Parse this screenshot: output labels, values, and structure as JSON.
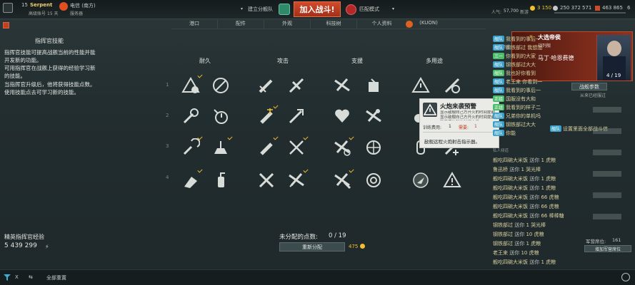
{
  "topbar": {
    "player_name": "Serpent",
    "player_level": "15",
    "player_rank": "高级账号",
    "player_sub": "15 天",
    "server_name": "电信 (南方)",
    "server_sub": "服务器",
    "division_label": "建立分舰队",
    "battle_button": "加入战斗!",
    "battle_mode": "匹配模式",
    "online_label": "人气:",
    "online_count": "57,700",
    "players_label": "新游",
    "doubloons": "3 150",
    "credits": "250 372",
    "free_xp": "571",
    "coal": "463 865",
    "currency_extra": "6"
  },
  "subnav": {
    "tabs": [
      "港口",
      "配件",
      "外观",
      "科技树",
      "个人资料",
      "(KUON)"
    ]
  },
  "left_panel": {
    "title": "指挥官技能",
    "paragraphs": [
      "指挥官技能可提高战舰当前的性能并能开发新的功能。",
      "可用指挥官在战舰上获得的经验学习新的技能。",
      "当指挥官升级后，他将获得技能点数。使用技能点去可学习新的技能。"
    ],
    "elite_xp_label": "精英指挥官经验",
    "elite_xp_value": "5 439 299"
  },
  "categories": [
    "耐久",
    "攻击",
    "支援",
    "多用途"
  ],
  "skills": {
    "row_labels": [
      "1",
      "2",
      "3",
      "4"
    ]
  },
  "points": {
    "label": "未分配的点数:",
    "value": "0 / 19",
    "reset_button": "重新分配",
    "reset_cost": "475"
  },
  "tooltip": {
    "title": "火炮来袭预警",
    "desc": "显示敌舰向己方开火的时间提前显示敌舰向己方开火的时间提前和来袭炮弹的时间大于",
    "cost_label": "训练费用:",
    "cost_value": "1",
    "req_label": "需要:",
    "req_value": "1",
    "footer": "敌舰远程火炮射击指示器。"
  },
  "ship_card": {
    "title": "大选帝侯",
    "subtitle": "战列舰",
    "commander": "马丁·哈恩费德",
    "level_text": "4 / 19",
    "details_button": "战舰参数",
    "note": "从来已经服过",
    "tier": "X"
  },
  "chat": {
    "header": "公频频道",
    "lines": [
      {
        "tag": "舰队",
        "text": "我看到的事后一"
      },
      {
        "tag": "舰队",
        "text": "钢铁部过 我想加"
      },
      {
        "tag": "三一",
        "text": "你看到的大家"
      },
      {
        "tag": "舰队",
        "text": "钢铁部过大大"
      },
      {
        "tag": "舰队",
        "text": "我也好你看到"
      },
      {
        "tag": "舰队",
        "text": "老王来 你看到一"
      },
      {
        "tag": "舰队",
        "text": "我看到的事后一"
      },
      {
        "tag": "正组",
        "text": "国服没有大和"
      },
      {
        "tag": "正组",
        "text": "我看到的样子二"
      },
      {
        "tag": "舰队",
        "text": "兄弟你的单机吗"
      },
      {
        "tag": "舰队",
        "text": "钢铁部过大大"
      },
      {
        "tag": "舰队",
        "text": "你能"
      },
      {
        "tag": "舰队",
        "text": "设置里面全部战斗信"
      }
    ],
    "system_header": "私人频道",
    "gifts": [
      {
        "name": "舰吃四碗大米饭",
        "verb": "送你",
        "qty": "1",
        "item": "虎粮"
      },
      {
        "name": "鲁迅桥",
        "verb": "送你",
        "qty": "1",
        "item": "哭光棒"
      },
      {
        "name": "舰吃四碗大米饭",
        "verb": "送你",
        "qty": "1",
        "item": "虎粮"
      },
      {
        "name": "舰吃四碗大米饭",
        "verb": "送你",
        "qty": "1",
        "item": "虎粮"
      },
      {
        "name": "舰吃四碗大米饭",
        "verb": "送你",
        "qty": "66",
        "item": "虎粮"
      },
      {
        "name": "舰吃四碗大米饭",
        "verb": "送你",
        "qty": "66",
        "item": "虎粮"
      },
      {
        "name": "舰吃四碗大米饭",
        "verb": "送你",
        "qty": "66",
        "item": "棒棒糖"
      },
      {
        "name": "钢铁部过",
        "verb": "送你",
        "qty": "1",
        "item": "哭光棒"
      },
      {
        "name": "钢铁部过",
        "verb": "送你",
        "qty": "10",
        "item": "虎粮"
      },
      {
        "name": "钢铁部过",
        "verb": "送你",
        "qty": "1",
        "item": "虎粮"
      },
      {
        "name": "老王来",
        "verb": "送你",
        "qty": "10",
        "item": "虎粮"
      },
      {
        "name": "舰吃四碗大米饭",
        "verb": "送你",
        "qty": "1",
        "item": "虎粮"
      }
    ],
    "queue_label": "军营席位:",
    "queue_value": "161",
    "add_button": "增加军营席位"
  },
  "bottombar": {
    "filter_x": "X",
    "reset_all": "全部重置"
  },
  "colors": {
    "accent_red": "#c0401f",
    "gold": "#f0c030",
    "chat_chip": "#3aa0c8"
  }
}
